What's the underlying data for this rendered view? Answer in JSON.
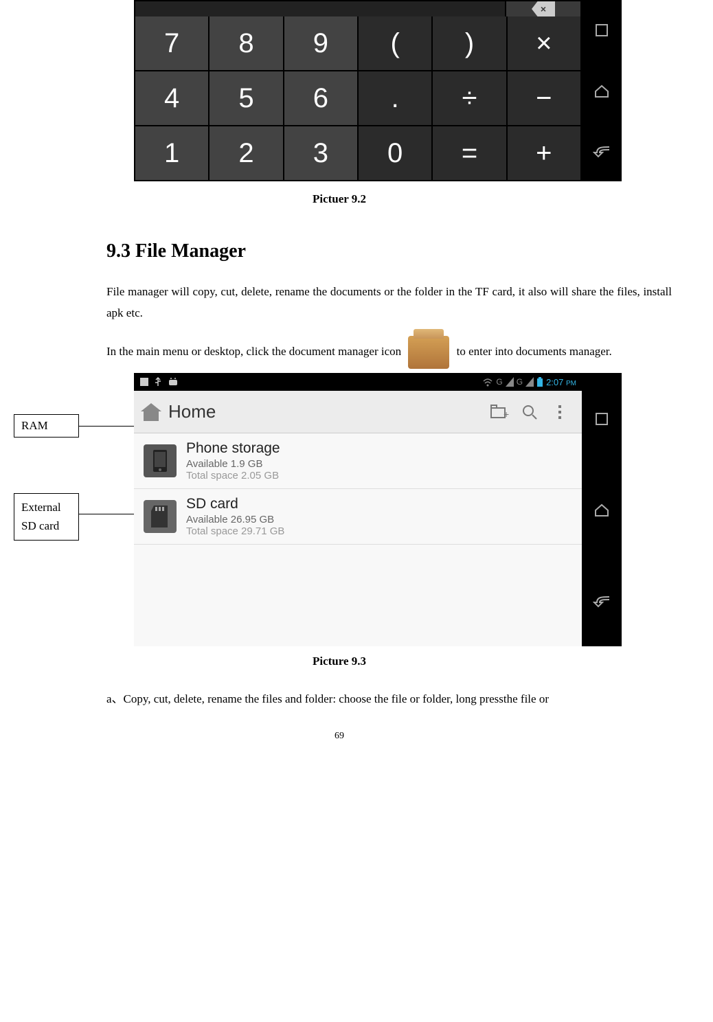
{
  "calculator": {
    "keys_row1": [
      "7",
      "8",
      "9",
      "(",
      ")",
      "×"
    ],
    "keys_row2": [
      "4",
      "5",
      "6",
      ".",
      "÷",
      "−"
    ],
    "keys_row3": [
      "1",
      "2",
      "3",
      "0",
      "=",
      "+"
    ],
    "caption": "Pictuer 9.2"
  },
  "section": {
    "heading": "9.3 File Manager",
    "para1": "File manager will copy, cut, delete, rename the documents or the folder in the TF card, it also will share the files, install apk etc.",
    "para2a": "In the main menu or desktop, click the document manager icon ",
    "para2b": " to enter into documents manager."
  },
  "annotations": {
    "ram": "RAM",
    "ext1": "External",
    "ext2": "SD card"
  },
  "filemanager": {
    "time": "2:07",
    "time_ampm": "PM",
    "signal_g": "G",
    "title": "Home",
    "items": [
      {
        "name": "Phone storage",
        "avail": "Available 1.9 GB",
        "total": "Total space 2.05 GB"
      },
      {
        "name": "SD card",
        "avail": "Available 26.95 GB",
        "total": "Total space 29.71 GB"
      }
    ],
    "caption": "Picture 9.3"
  },
  "footer": {
    "para": "a、Copy, cut, delete, rename the files and folder: choose the file or folder, long pressthe file or",
    "page": "69"
  }
}
